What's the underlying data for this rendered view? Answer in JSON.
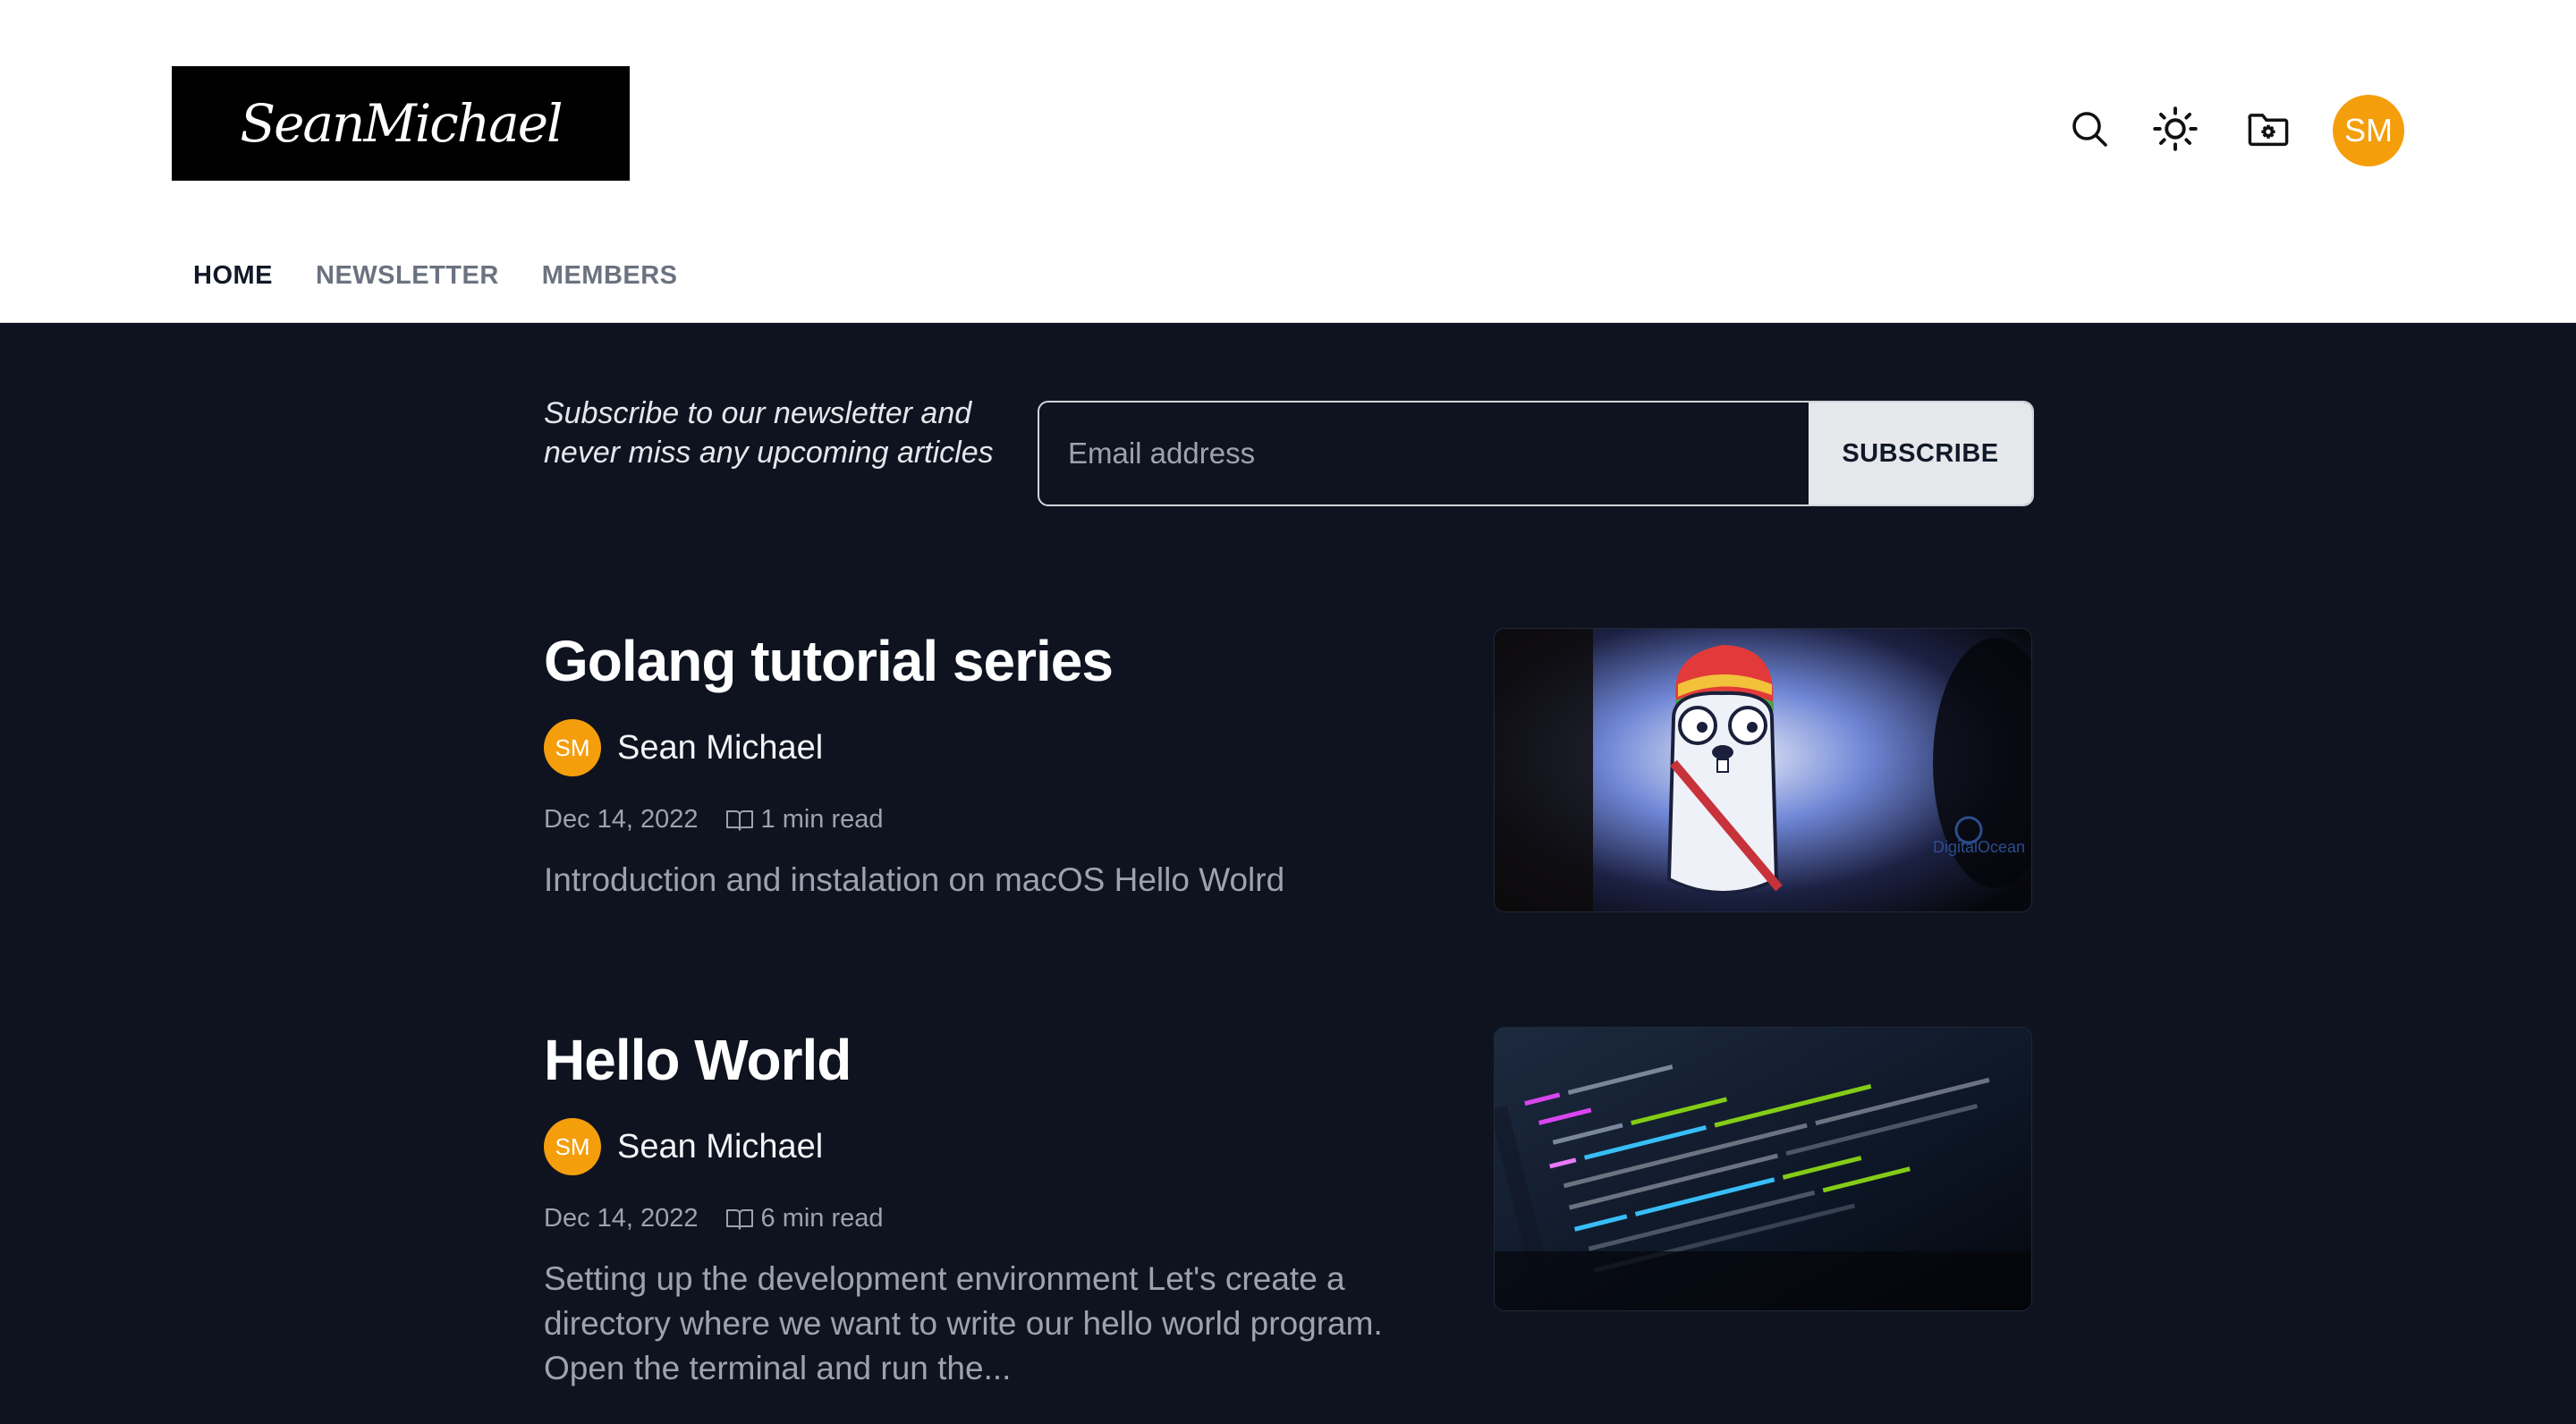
{
  "header": {
    "logo_text": "SeanMichael",
    "avatar_initials": "SM"
  },
  "nav": {
    "items": [
      {
        "label": "HOME",
        "active": true
      },
      {
        "label": "NEWSLETTER",
        "active": false
      },
      {
        "label": "MEMBERS",
        "active": false
      }
    ]
  },
  "subscribe": {
    "text": "Subscribe to our newsletter and never miss any upcoming articles",
    "placeholder": "Email address",
    "button_label": "SUBSCRIBE"
  },
  "posts": [
    {
      "title": "Golang tutorial series",
      "author_initials": "SM",
      "author": "Sean Michael",
      "date": "Dec 14, 2022",
      "read_time": "1 min read",
      "excerpt": "Introduction and instalation on macOS Hello Wolrd"
    },
    {
      "title": "Hello World",
      "author_initials": "SM",
      "author": "Sean Michael",
      "date": "Dec 14, 2022",
      "read_time": "6 min read",
      "excerpt": "Setting up the development environment Let's create a directory where we want to write our hello world program. Open the terminal and run the..."
    }
  ],
  "colors": {
    "accent": "#f59e0b",
    "background": "#0f1320"
  }
}
